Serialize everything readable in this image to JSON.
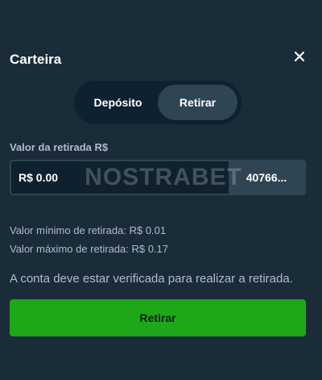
{
  "wallet": {
    "title": "Carteira",
    "close_icon": "close-icon"
  },
  "tabs": [
    {
      "label": "Depósito",
      "active": false
    },
    {
      "label": "Retirar",
      "active": true
    }
  ],
  "withdraw": {
    "amount_label": "Valor da retirada R$",
    "amount_placeholder": "R$ 0.00",
    "crypto_value": "40766...",
    "min_text": "Valor mínimo de retirada: R$ 0.01",
    "max_text": "Valor máximo de retirada: R$ 0.17",
    "notice": "A conta deve estar verificada para realizar a retirada.",
    "submit_label": "Retirar"
  },
  "watermark": "NOSTRABET",
  "colors": {
    "background": "#1a2c38",
    "input_bg": "#0f212e",
    "accent_button": "#1fa71a",
    "active_tab": "#2f4553",
    "muted_text": "#b1bad3"
  }
}
